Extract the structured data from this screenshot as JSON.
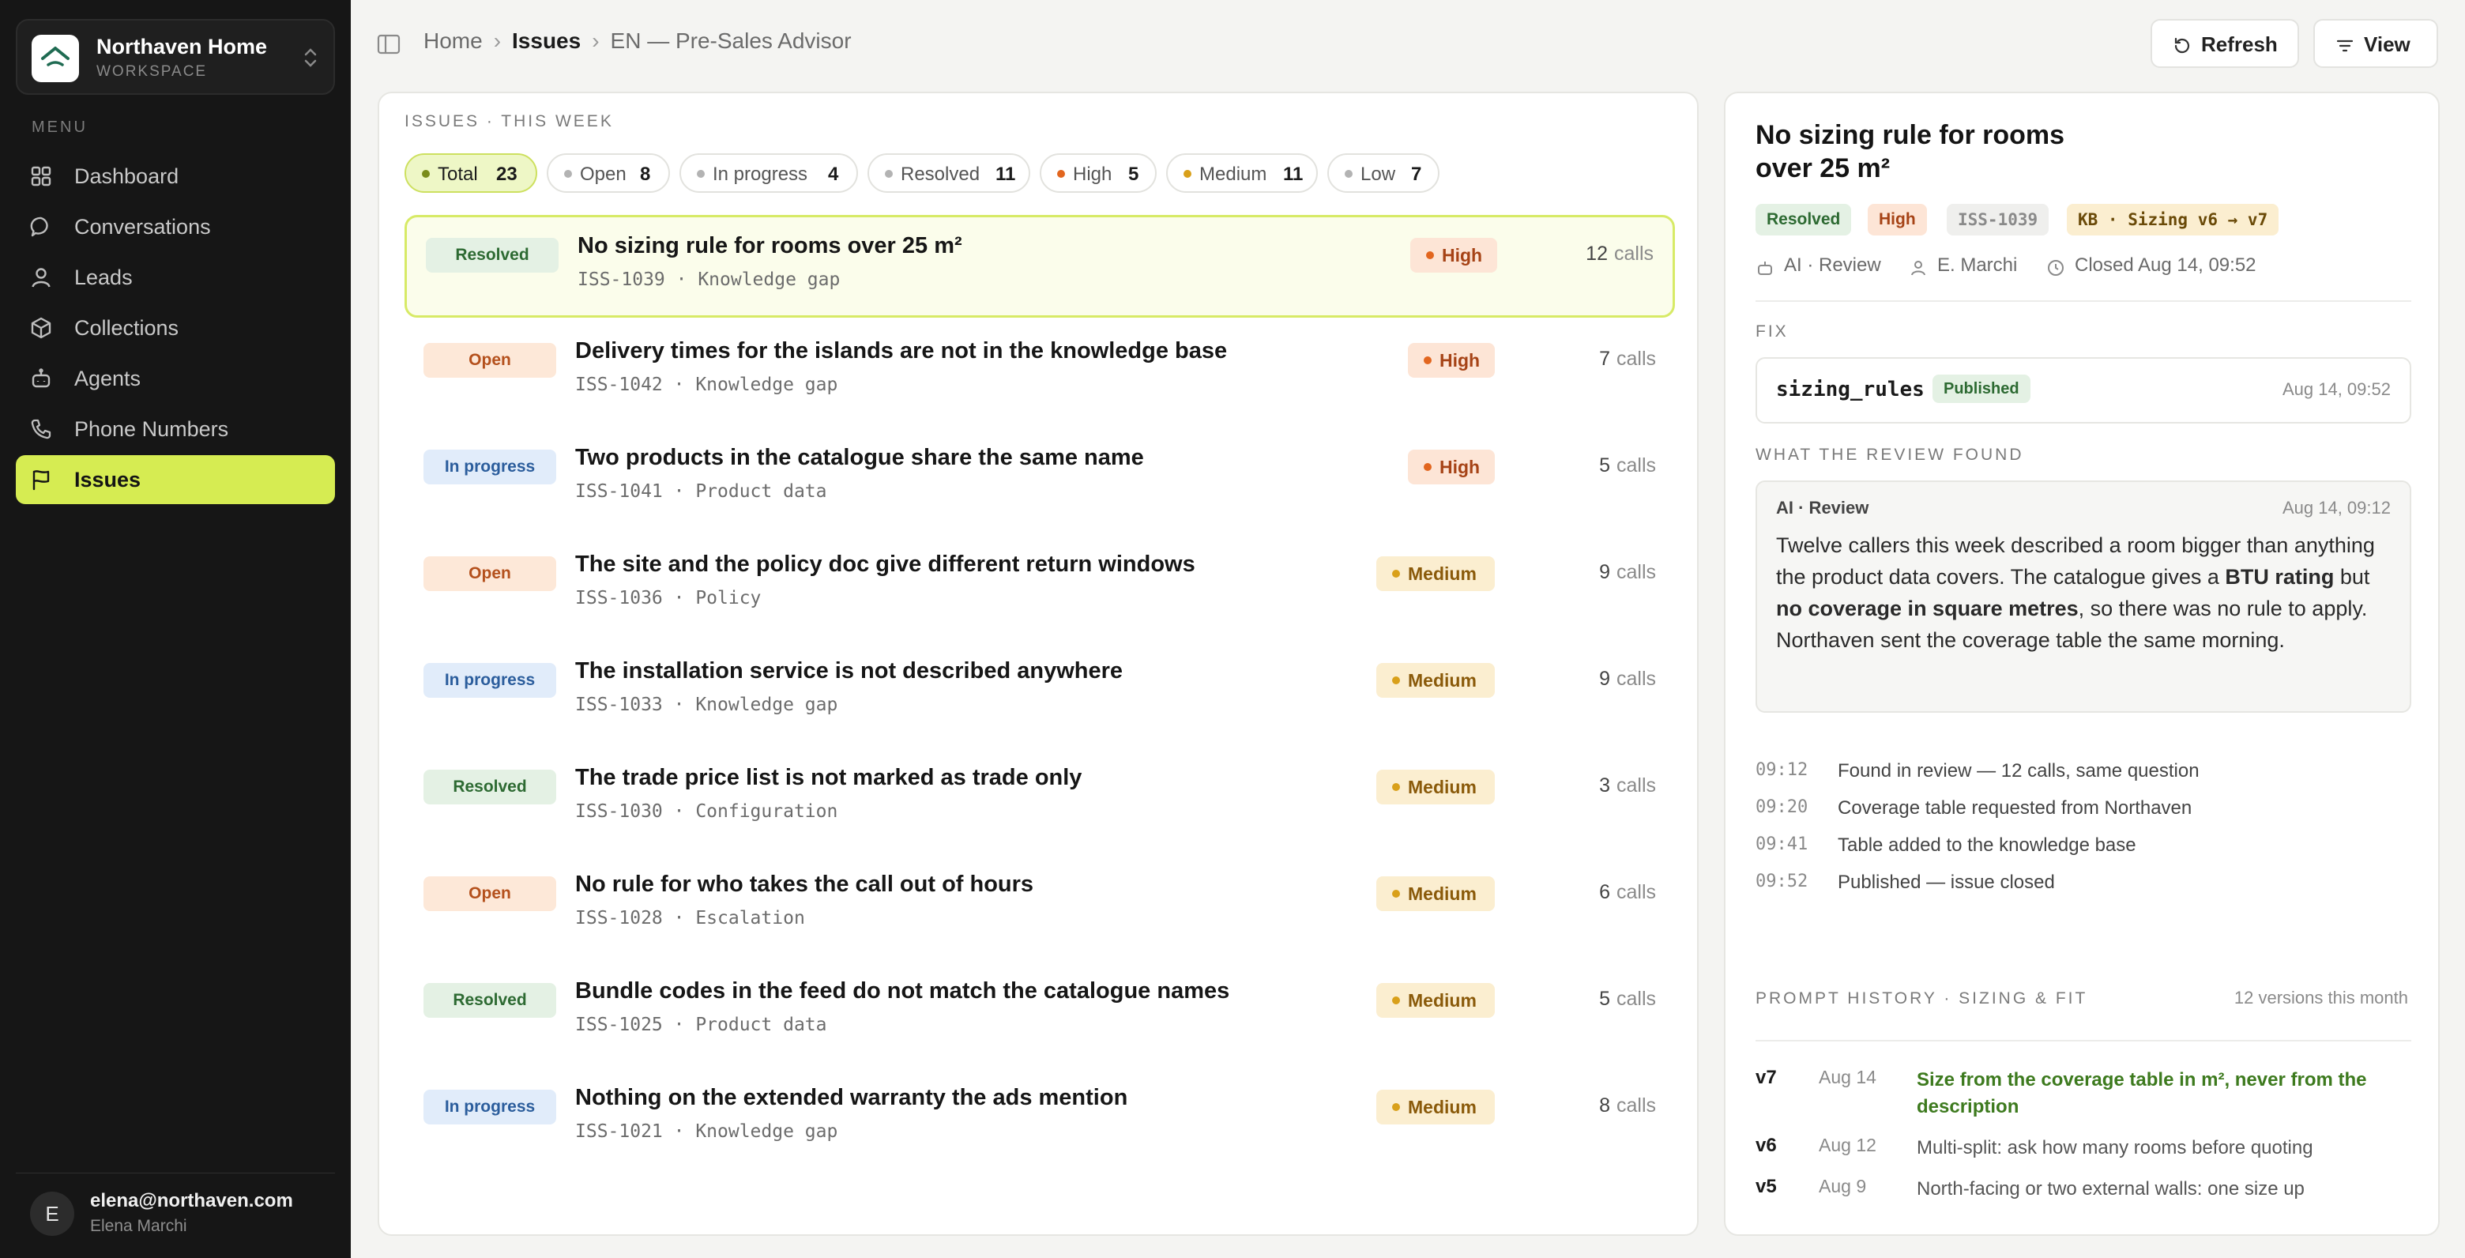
{
  "workspace": {
    "name": "Northaven Home",
    "subtitle": "WORKSPACE"
  },
  "sidebar": {
    "menu_label": "MENU",
    "items": [
      {
        "label": "Dashboard",
        "icon": "grid-icon"
      },
      {
        "label": "Conversations",
        "icon": "chat-bubble-icon"
      },
      {
        "label": "Leads",
        "icon": "user-icon"
      },
      {
        "label": "Collections",
        "icon": "box-icon"
      },
      {
        "label": "Agents",
        "icon": "robot-icon"
      },
      {
        "label": "Phone Numbers",
        "icon": "phone-icon"
      },
      {
        "label": "Issues",
        "icon": "flag-icon",
        "active": true
      }
    ]
  },
  "user": {
    "initial": "E",
    "email": "elena@northaven.com",
    "name": "Elena Marchi"
  },
  "breadcrumb": [
    "Home",
    "Issues",
    "EN — Pre-Sales Advisor"
  ],
  "toolbar": {
    "refresh_label": "Refresh",
    "view_label": "View"
  },
  "issues": {
    "title": "ISSUES · THIS WEEK",
    "filters": [
      {
        "label": "Total",
        "count": "23"
      },
      {
        "label": "Open",
        "count": "8"
      },
      {
        "label": "In progress",
        "count": "4"
      },
      {
        "label": "Resolved",
        "count": "11"
      },
      {
        "label": "High",
        "count": "5"
      },
      {
        "label": "Medium",
        "count": "11"
      },
      {
        "label": "Low",
        "count": "7"
      }
    ],
    "rows": [
      {
        "status": "Resolved",
        "title": "No sizing rule for rooms over 25 m²",
        "sub": "ISS-1039 · Knowledge gap",
        "priority": "High",
        "calls": "12",
        "calls_label": "calls"
      },
      {
        "status": "Open",
        "title": "Delivery times for the islands are not in the knowledge base",
        "sub": "ISS-1042 · Knowledge gap",
        "priority": "High",
        "calls": "7",
        "calls_label": "calls"
      },
      {
        "status": "In progress",
        "title": "Two products in the catalogue share the same name",
        "sub": "ISS-1041 · Product data",
        "priority": "High",
        "calls": "5",
        "calls_label": "calls"
      },
      {
        "status": "Open",
        "title": "The site and the policy doc give different return windows",
        "sub": "ISS-1036 · Policy",
        "priority": "Medium",
        "calls": "9",
        "calls_label": "calls"
      },
      {
        "status": "In progress",
        "title": "The installation service is not described anywhere",
        "sub": "ISS-1033 · Knowledge gap",
        "priority": "Medium",
        "calls": "9",
        "calls_label": "calls"
      },
      {
        "status": "Resolved",
        "title": "The trade price list is not marked as trade only",
        "sub": "ISS-1030 · Configuration",
        "priority": "Medium",
        "calls": "3",
        "calls_label": "calls"
      },
      {
        "status": "Open",
        "title": "No rule for who takes the call out of hours",
        "sub": "ISS-1028 · Escalation",
        "priority": "Medium",
        "calls": "6",
        "calls_label": "calls"
      },
      {
        "status": "Resolved",
        "title": "Bundle codes in the feed do not match the catalogue names",
        "sub": "ISS-1025 · Product data",
        "priority": "Medium",
        "calls": "5",
        "calls_label": "calls"
      },
      {
        "status": "In progress",
        "title": "Nothing on the extended warranty the ads mention",
        "sub": "ISS-1021 · Knowledge gap",
        "priority": "Medium",
        "calls": "8",
        "calls_label": "calls"
      }
    ]
  },
  "detail": {
    "title": "No sizing rule for rooms over 25 m²",
    "tags": {
      "status": "Resolved",
      "priority": "High",
      "id": "ISS-1039",
      "kb": "KB · Sizing v6 → v7"
    },
    "meta": {
      "source": "AI · Review",
      "owner": "E. Marchi",
      "closed": "Closed Aug 14, 09:52"
    },
    "fix_label": "FIX",
    "fix": {
      "name": "sizing_rules",
      "state": "Published",
      "date": "Aug 14, 09:52"
    },
    "review_label": "WHAT THE REVIEW FOUND",
    "review": {
      "source": "AI · Review",
      "time": "Aug 14, 09:12",
      "text_1": "Twelve callers this week described a room bigger than anything the product data covers. The catalogue gives a ",
      "bold_1": "BTU rating",
      "text_2": " but ",
      "bold_2": "no coverage in square metres",
      "text_3": ", so there was no rule to apply. Northaven sent the coverage table the same morning."
    },
    "timeline": [
      {
        "time": "09:12",
        "text": "Found in review — 12 calls, same question"
      },
      {
        "time": "09:20",
        "text": "Coverage table requested from Northaven"
      },
      {
        "time": "09:41",
        "text": "Table added to the knowledge base"
      },
      {
        "time": "09:52",
        "text": "Published — issue closed"
      }
    ],
    "prompt_history_label": "PROMPT HISTORY · SIZING & FIT",
    "prompt_history_count": "12 versions this month",
    "versions": [
      {
        "v": "v7",
        "date": "Aug 14",
        "desc": "Size from the coverage table in m², never from the description",
        "current": true
      },
      {
        "v": "v6",
        "date": "Aug 12",
        "desc": "Multi-split: ask how many rooms before quoting"
      },
      {
        "v": "v5",
        "date": "Aug 9",
        "desc": "North-facing or two external walls: one size up"
      }
    ]
  }
}
